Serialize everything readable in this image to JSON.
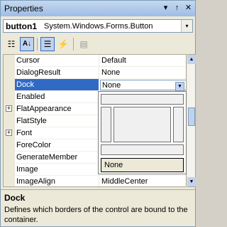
{
  "window": {
    "title": "Properties",
    "pin_glyph": "↑",
    "dropdown_glyph": "▾",
    "close_glyph": "✕"
  },
  "object_selector": {
    "name": "button1",
    "type": "System.Windows.Forms.Button",
    "arrow": "▾"
  },
  "toolbar": [
    {
      "name": "categorized",
      "icon": "categorized-icon",
      "glyph": "☷"
    },
    {
      "name": "alphabetical",
      "icon": "alphabetical-sort-icon",
      "glyph": "A↓"
    },
    {
      "name": "properties",
      "icon": "properties-icon",
      "glyph": "☰"
    },
    {
      "name": "events",
      "icon": "lightning-icon",
      "glyph": "⚡"
    },
    {
      "name": "property-pages",
      "icon": "property-pages-icon",
      "glyph": "▤"
    }
  ],
  "properties": [
    {
      "name": "Cursor",
      "value": "Default",
      "expandable": false
    },
    {
      "name": "DialogResult",
      "value": "None",
      "expandable": false
    },
    {
      "name": "Dock",
      "value": "None",
      "expandable": false,
      "selected": true
    },
    {
      "name": "Enabled",
      "value": "",
      "expandable": false
    },
    {
      "name": "FlatAppearance",
      "value": "",
      "expandable": true
    },
    {
      "name": "FlatStyle",
      "value": "",
      "expandable": false
    },
    {
      "name": "Font",
      "value": "",
      "expandable": true
    },
    {
      "name": "ForeColor",
      "value": "",
      "expandable": false
    },
    {
      "name": "GenerateMember",
      "value": "",
      "expandable": false
    },
    {
      "name": "Image",
      "value": "",
      "expandable": false
    },
    {
      "name": "ImageAlign",
      "value": "MiddleCenter",
      "expandable": false
    }
  ],
  "expand_glyph": "+",
  "dock_editor": {
    "none_label": "None"
  },
  "scrollbar": {
    "up": "▲",
    "down": "▼"
  },
  "description": {
    "title": "Dock",
    "text": "Defines which borders of the control are bound to the container."
  },
  "colors": {
    "selection": "#316ac5",
    "panel": "#ece9d8"
  }
}
